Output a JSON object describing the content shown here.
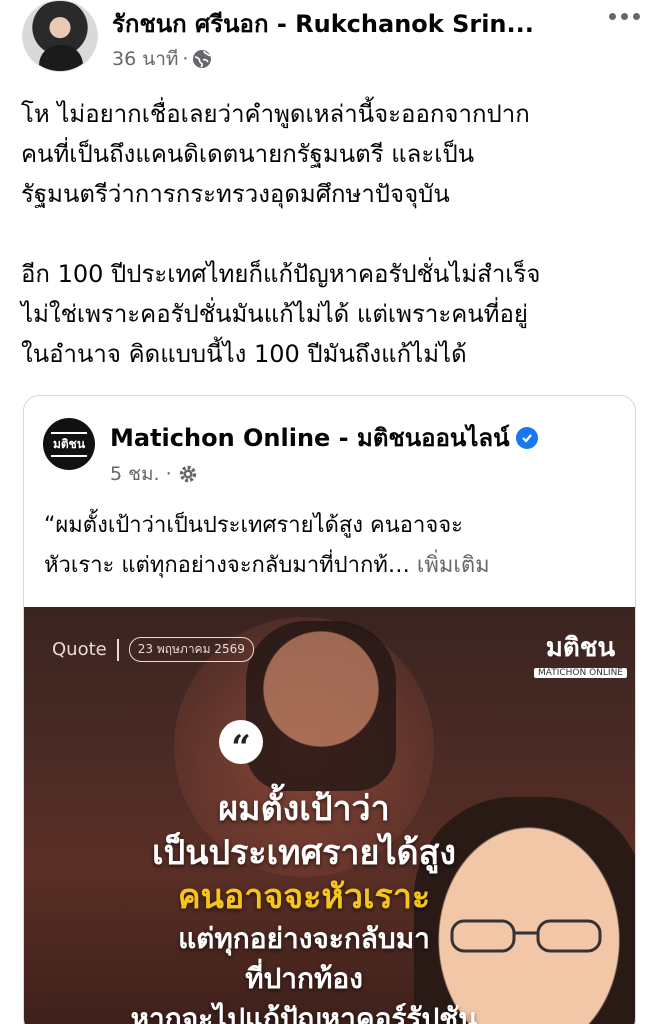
{
  "post": {
    "author_name": "รักชนก ศรีนอก - Rukchanok Srin...",
    "time": "36 นาที",
    "dot": "·",
    "body_lines": [
      "โห ไม่อยากเชื่อเลยว่าคำพูดเหล่านี้จะออกจากปาก",
      "คนที่เป็นถึงแคนดิเดตนายกรัฐมนตรี และเป็น",
      "รัฐมนตรีว่าการกระทรวงอุดมศึกษาปัจจุบัน",
      "อีก 100 ปีประเทศไทยก็แก้ปัญหาคอรัปชั่นไม่สำเร็จ",
      "ไม่ใช่เพราะคอรัปชั่นมันแก้ไม่ได้ แต่เพราะคนที่อยู่",
      "ในอำนาจ คิดแบบนี้ไง 100 ปีมันถึงแก้ไม่ได้"
    ],
    "icons": {
      "privacy": "globe-icon",
      "more": "more-options-icon",
      "avatar": "avatar"
    }
  },
  "shared": {
    "page_name": "Matichon Online - มติชนออนไลน์",
    "logo_text": "มติชน",
    "time": "5 ชม.",
    "dot": "·",
    "text_line1": "“ผมตั้งเป้าว่าเป็นประเทศรายได้สูง คนอาจจะ",
    "text_line2": "หัวเราะ แต่ทุกอย่างจะกลับมาที่ปากท้…",
    "see_more": "เพิ่มเติม",
    "icons": {
      "verified": "verified-badge-icon",
      "settings": "gear-icon"
    },
    "image": {
      "quote_label": "Quote",
      "date": "23 พฤษภาคม 2569",
      "brand": "มติชน",
      "brand_sub": "MATICHON ONLINE",
      "quote_mark": "“",
      "headline": [
        "ผมตั้งเป้าว่า",
        "เป็นประเทศรายได้สูง",
        "คนอาจจะหัวเราะ",
        "แต่ทุกอย่างจะกลับมา",
        "ที่ปากท้อง",
        "หากจะไปแก้ปัญหาคอร์รัปชัน"
      ]
    }
  },
  "colors": {
    "text": "#050505",
    "secondary": "#65676b",
    "verified": "#1877f2",
    "highlight": "#f6c51a",
    "border": "#d6d8dc"
  }
}
